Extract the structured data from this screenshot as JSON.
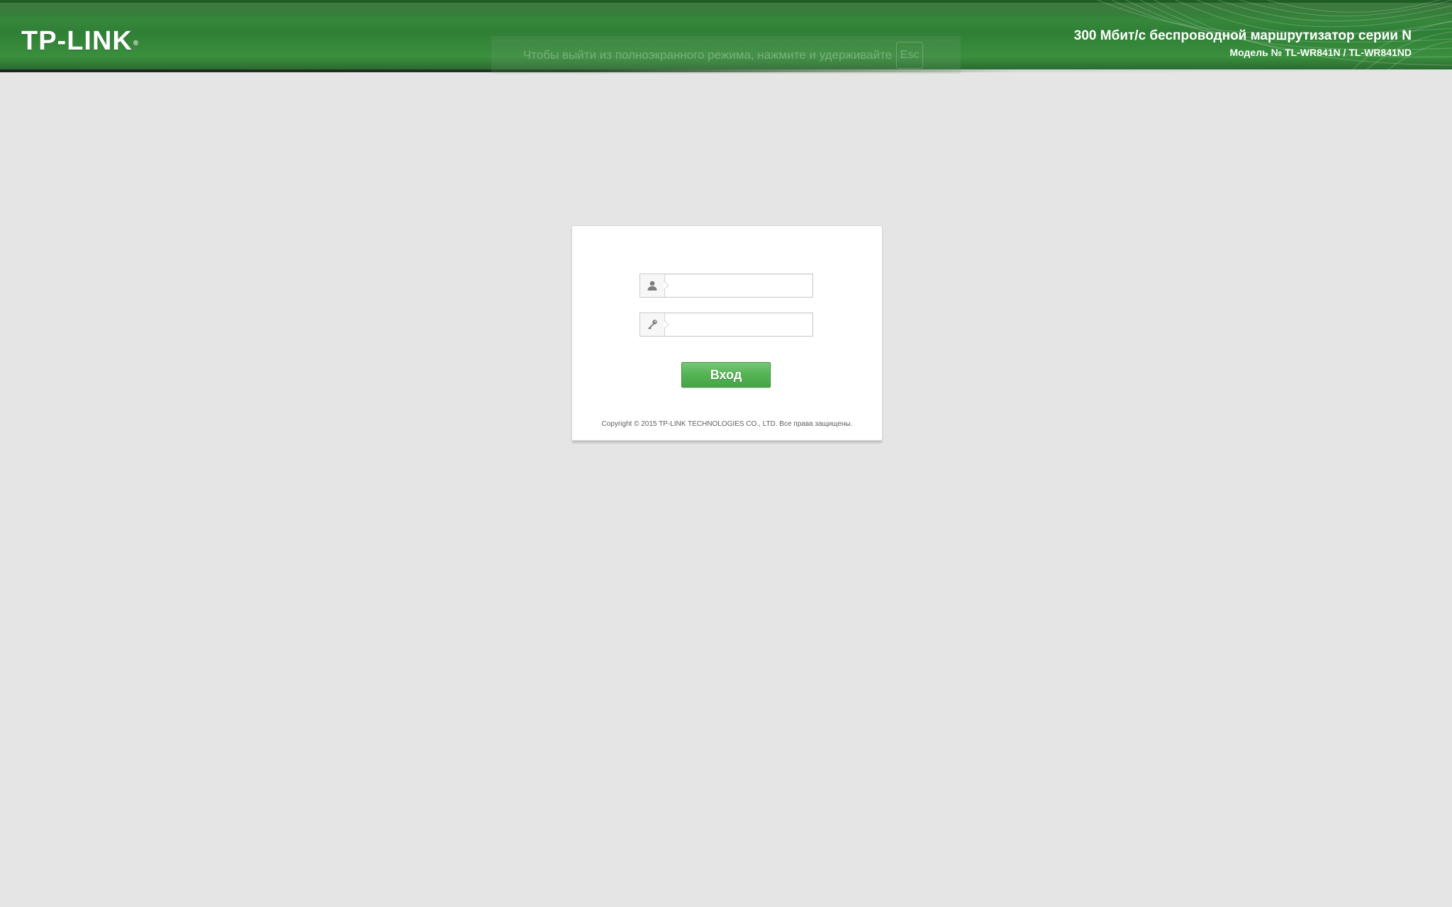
{
  "header": {
    "logo_text": "TP-LINK",
    "logo_mark": "®",
    "product_title": "300 Мбит/с беспроводной маршрутизатор серии N",
    "model_number": "Модель № TL-WR841N / TL-WR841ND"
  },
  "fullscreen_notice": {
    "text": "Чтобы выйти из полноэкранного режима, нажмите и удерживайте",
    "key": "Esc"
  },
  "login": {
    "username": {
      "icon": "user-icon",
      "value": "",
      "placeholder": ""
    },
    "password": {
      "icon": "key-icon",
      "value": "",
      "placeholder": ""
    },
    "button_label": "Вход",
    "copyright": "Copyright © 2015 TP-LINK TECHNOLOGIES CO., LTD. Все права защищены."
  },
  "colors": {
    "header_green": "#3a8a3f",
    "button_green": "#56b456",
    "background": "#e5e5e5"
  }
}
